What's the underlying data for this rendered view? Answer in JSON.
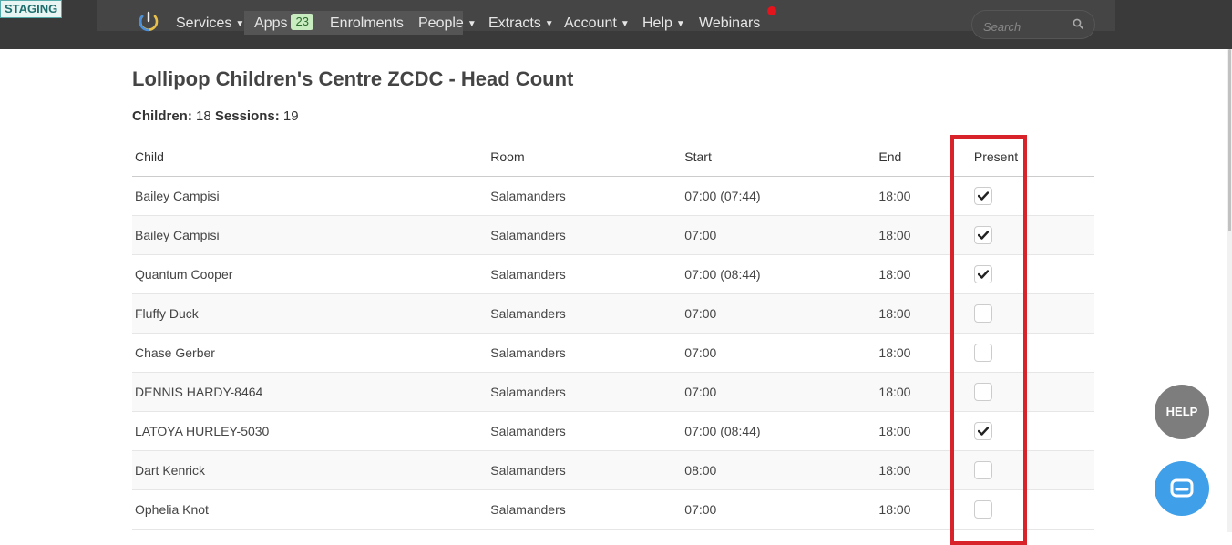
{
  "env_badge": "STAGING",
  "nav": {
    "items": [
      {
        "label": "Services",
        "caret": true
      },
      {
        "label": "Apps",
        "badge": "23"
      },
      {
        "label": "Enrolments"
      },
      {
        "label": "People",
        "caret": true
      },
      {
        "label": "Extracts",
        "caret": true
      },
      {
        "label": "Account",
        "caret": true
      },
      {
        "label": "Help",
        "caret": true
      },
      {
        "label": "Webinars"
      }
    ],
    "search_placeholder": "Search"
  },
  "page": {
    "title": "Lollipop Children's Centre ZCDC - Head Count",
    "children_label": "Children:",
    "children_count": "18",
    "sessions_label": "Sessions:",
    "sessions_count": "19"
  },
  "table": {
    "headers": {
      "child": "Child",
      "room": "Room",
      "start": "Start",
      "end": "End",
      "present": "Present"
    },
    "rows": [
      {
        "child": "Bailey Campisi",
        "room": "Salamanders",
        "start": "07:00 (07:44)",
        "end": "18:00",
        "present": true
      },
      {
        "child": "Bailey Campisi",
        "room": "Salamanders",
        "start": "07:00",
        "end": "18:00",
        "present": true
      },
      {
        "child": "Quantum Cooper",
        "room": "Salamanders",
        "start": "07:00 (08:44)",
        "end": "18:00",
        "present": true
      },
      {
        "child": "Fluffy Duck",
        "room": "Salamanders",
        "start": "07:00",
        "end": "18:00",
        "present": false
      },
      {
        "child": "Chase Gerber",
        "room": "Salamanders",
        "start": "07:00",
        "end": "18:00",
        "present": false
      },
      {
        "child": "DENNIS HARDY-8464",
        "room": "Salamanders",
        "start": "07:00",
        "end": "18:00",
        "present": false
      },
      {
        "child": "LATOYA HURLEY-5030",
        "room": "Salamanders",
        "start": "07:00 (08:44)",
        "end": "18:00",
        "present": true
      },
      {
        "child": "Dart Kenrick",
        "room": "Salamanders",
        "start": "08:00",
        "end": "18:00",
        "present": false
      },
      {
        "child": "Ophelia Knot",
        "room": "Salamanders",
        "start": "07:00",
        "end": "18:00",
        "present": false
      }
    ]
  },
  "help_button": "HELP",
  "colors": {
    "navbar": "#3a3a3a",
    "highlight": "#d9232a",
    "chat": "#3f9fe8",
    "help": "#7d7d7d",
    "badge": "#c8ecc0"
  }
}
